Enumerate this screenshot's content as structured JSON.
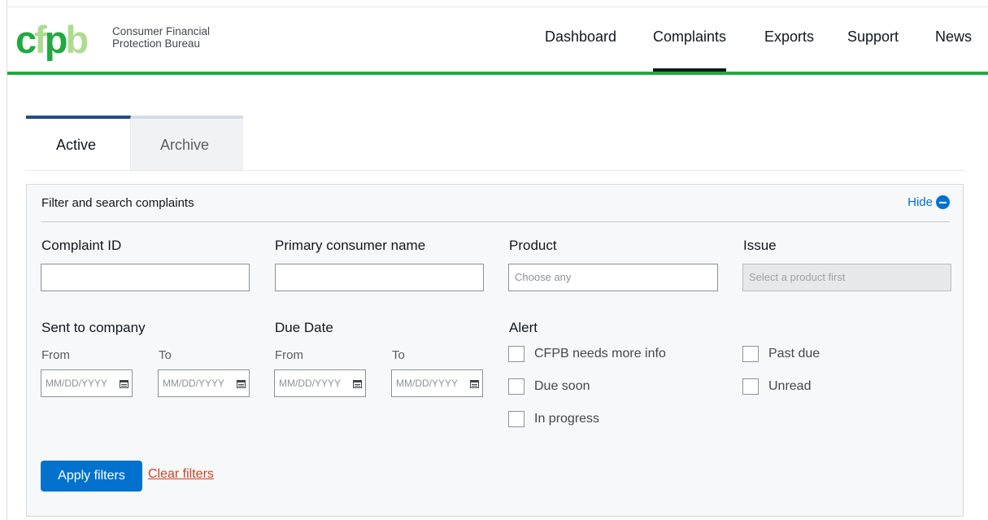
{
  "header": {
    "logo_text": "cfpb",
    "org_name_line1": "Consumer Financial",
    "org_name_line2": "Protection Bureau",
    "nav": [
      {
        "label": "Dashboard",
        "active": false
      },
      {
        "label": "Complaints",
        "active": true
      },
      {
        "label": "Exports",
        "active": false
      },
      {
        "label": "Support",
        "active": false
      },
      {
        "label": "News",
        "active": false
      }
    ]
  },
  "tabs": [
    {
      "label": "Active",
      "active": true
    },
    {
      "label": "Archive",
      "active": false
    }
  ],
  "filter_panel": {
    "title": "Filter and search complaints",
    "hide_label": "Hide",
    "hide_icon": "minus-circle-icon",
    "fields": {
      "complaint_id": {
        "label": "Complaint ID",
        "value": "",
        "placeholder": ""
      },
      "consumer_name": {
        "label": "Primary consumer name",
        "value": "",
        "placeholder": ""
      },
      "product": {
        "label": "Product",
        "placeholder": "Choose any"
      },
      "issue": {
        "label": "Issue",
        "placeholder": "Select a product first",
        "disabled": true
      }
    },
    "sent_to_company": {
      "label": "Sent to company",
      "from_label": "From",
      "to_label": "To",
      "from_placeholder": "MM/DD/YYYY",
      "to_placeholder": "MM/DD/YYYY"
    },
    "due_date": {
      "label": "Due Date",
      "from_label": "From",
      "to_label": "To",
      "from_placeholder": "MM/DD/YYYY",
      "to_placeholder": "MM/DD/YYYY"
    },
    "alert": {
      "label": "Alert",
      "options": [
        {
          "label": "CFPB needs more info",
          "checked": false
        },
        {
          "label": "Due soon",
          "checked": false
        },
        {
          "label": "In progress",
          "checked": false
        },
        {
          "label": "Past due",
          "checked": false
        },
        {
          "label": "Unread",
          "checked": false
        }
      ]
    },
    "apply_label": "Apply filters",
    "clear_label": "Clear filters"
  },
  "colors": {
    "brand_green": "#20aa3f",
    "logo_green_light": "#addc91",
    "primary_blue": "#0072ce",
    "tab_active_border": "#254b87",
    "clear_red": "#d14124"
  }
}
